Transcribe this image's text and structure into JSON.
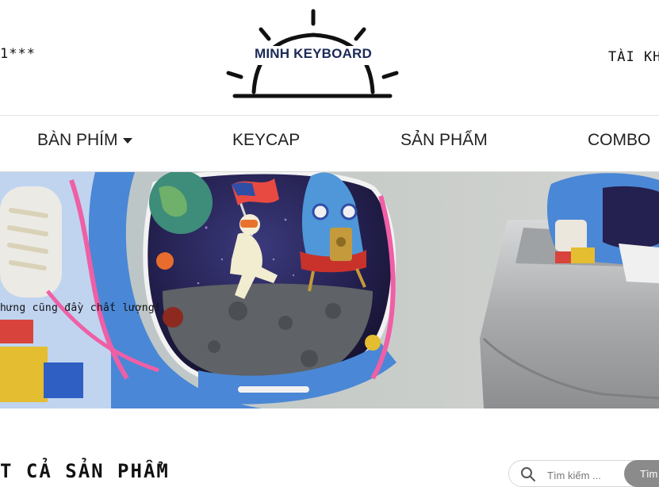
{
  "header": {
    "phone_text": "1***",
    "account_label": "TÀI KH",
    "logo_text": "MINH KEYBOARD"
  },
  "nav": {
    "items": [
      {
        "label": "BÀN PHÍM",
        "has_dropdown": true
      },
      {
        "label": "KEYCAP"
      },
      {
        "label": "SẢN PHẨM"
      },
      {
        "label": "COMBO"
      }
    ]
  },
  "banner": {
    "overlay_text": "hưng cũng đầy chất lượng!"
  },
  "products": {
    "section_title": "T CẢ SẢN PHẨM"
  },
  "search": {
    "placeholder": "Tìm kiếm ...",
    "button_label": "Tìm"
  },
  "colors": {
    "logo_navy": "#1b2a57",
    "search_button": "#8b8b8b",
    "divider": "#e3e3e3"
  }
}
